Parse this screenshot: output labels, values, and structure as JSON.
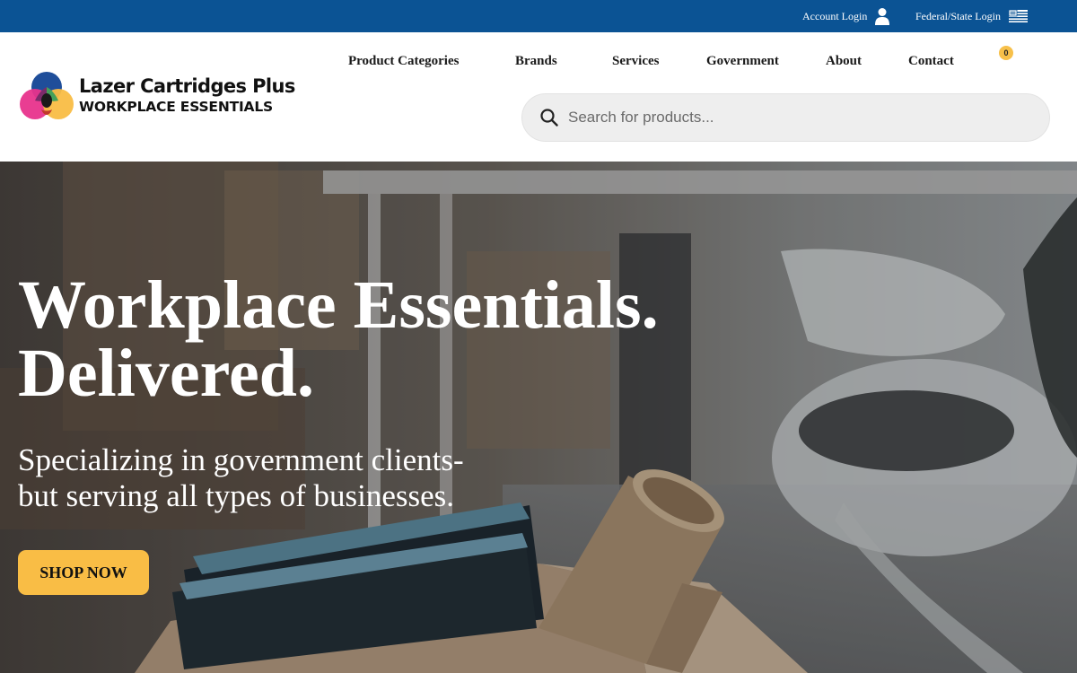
{
  "topbar": {
    "account_login": "Account Login",
    "federal_login": "Federal/State Login",
    "account_icon": "user-icon",
    "federal_icon": "us-flag-icon",
    "background_color": "#0b5394"
  },
  "logo": {
    "line1": "Lazer Cartridges Plus",
    "line2": "WORKPLACE ESSENTIALS",
    "mark_colors": [
      "#1f4e9a",
      "#e8338c",
      "#f9bd45",
      "#44a05a"
    ]
  },
  "nav": {
    "items": [
      "Product Categories",
      "Brands",
      "Services",
      "Government",
      "About",
      "Contact"
    ]
  },
  "cart": {
    "count": "0",
    "badge_color": "#f7c04a"
  },
  "search": {
    "placeholder": "Search for products...",
    "value": "",
    "icon": "search-icon"
  },
  "hero": {
    "headline_line1": "Workplace Essentials.",
    "headline_line2": "Delivered.",
    "subline1": "Specializing in government clients-",
    "subline2": "but serving all types of businesses.",
    "cta_label": "SHOP NOW",
    "cta_color": "#f9bd45"
  }
}
